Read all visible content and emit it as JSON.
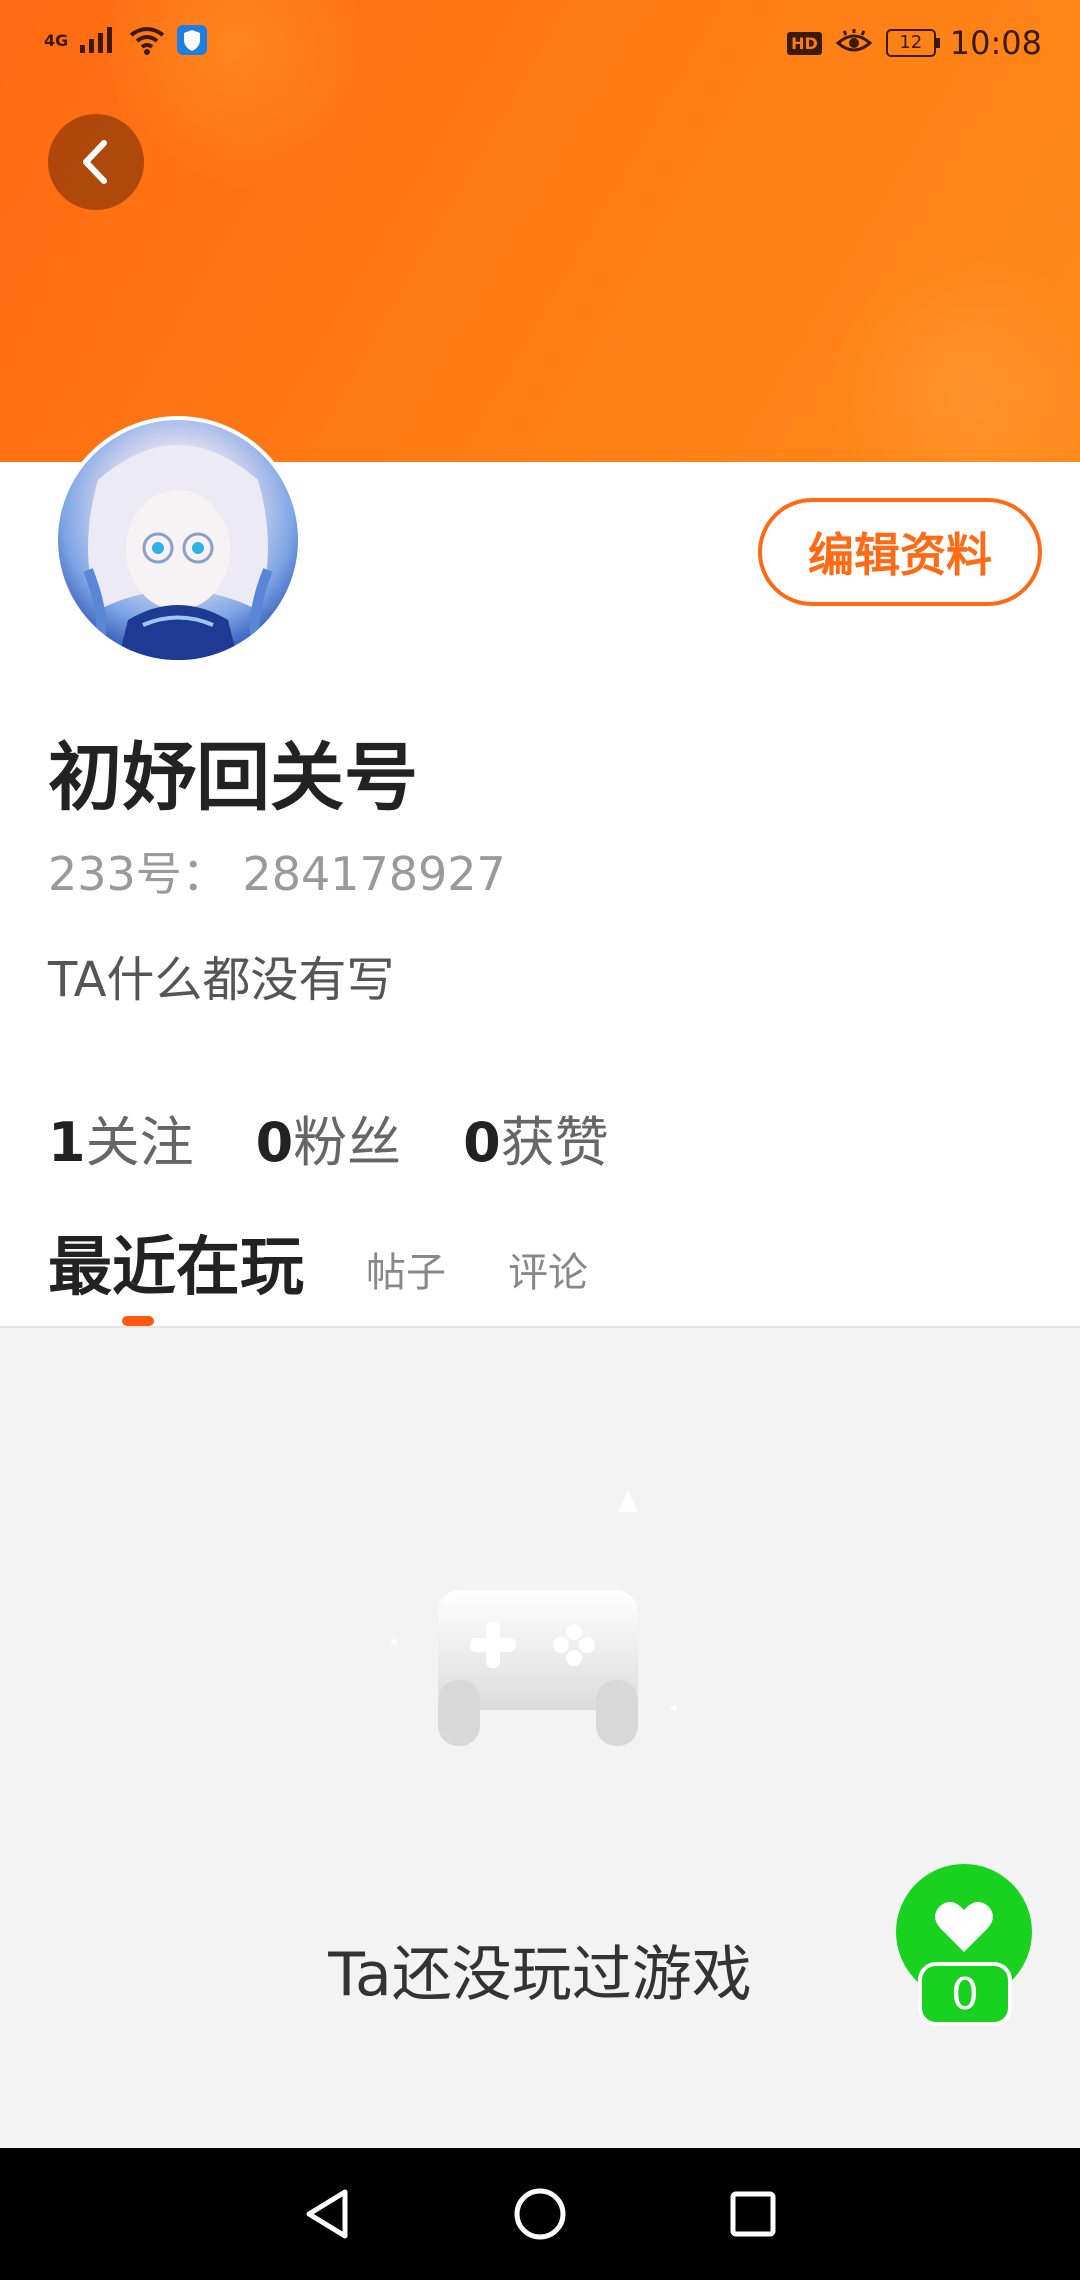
{
  "statusbar": {
    "network": "4G",
    "hd_badge": "HD",
    "battery": "12",
    "time": "10:08"
  },
  "profile": {
    "edit_button": "编辑资料",
    "name": "初妤回关号",
    "uid": "233号： 284178927",
    "bio": "TA什么都没有写"
  },
  "stats": [
    {
      "num": "1",
      "label": "关注"
    },
    {
      "num": "0",
      "label": "粉丝"
    },
    {
      "num": "0",
      "label": "获赞"
    }
  ],
  "tabs": {
    "active": "最近在玩",
    "posts": "帖子",
    "comments": "评论"
  },
  "empty": {
    "message": "Ta还没玩过游戏",
    "icon": "gamepad-icon"
  },
  "like": {
    "count": "0",
    "icon": "heart-icon"
  },
  "colors": {
    "accent": "#ff6a14",
    "like_green": "#19d11f"
  }
}
